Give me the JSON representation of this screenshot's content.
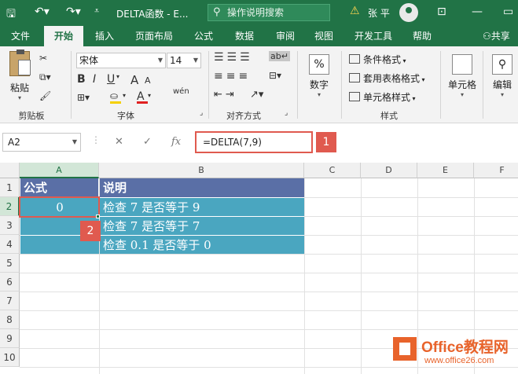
{
  "titlebar": {
    "title": "DELTA函数 - E...",
    "search_placeholder": "操作说明搜索",
    "user": "张 平",
    "save_icon": "save-icon",
    "undo_icon": "undo-icon",
    "redo_icon": "redo-icon"
  },
  "tabs": [
    "文件",
    "开始",
    "插入",
    "页面布局",
    "公式",
    "数据",
    "审阅",
    "视图",
    "开发工具",
    "帮助"
  ],
  "share_label": "共享",
  "ribbon": {
    "clipboard": {
      "paste": "粘贴",
      "label": "剪贴板"
    },
    "font": {
      "name": "宋体",
      "size": "14",
      "bold": "B",
      "italic": "I",
      "underline": "U",
      "grow": "A",
      "shrink": "A",
      "wen": "wén",
      "label": "字体"
    },
    "alignment": {
      "label": "对齐方式"
    },
    "number": {
      "symbol": "%",
      "name": "数字"
    },
    "styles": {
      "cond": "条件格式",
      "table": "套用表格格式",
      "cell": "单元格样式",
      "label": "样式"
    },
    "cells": {
      "name": "单元格"
    },
    "editing": {
      "name": "编辑"
    }
  },
  "formula_bar": {
    "namebox": "A2",
    "formula": "=DELTA(7,9)",
    "cancel": "✕",
    "enter": "✓",
    "fx": "fx",
    "badge1": "1"
  },
  "sheet": {
    "columns": [
      "A",
      "B",
      "C",
      "D",
      "E",
      "F"
    ],
    "rows": [
      "1",
      "2",
      "3",
      "4",
      "5",
      "6",
      "7",
      "8",
      "9",
      "10"
    ],
    "header": {
      "a": "公式",
      "b": "说明"
    },
    "data": [
      {
        "a": "0",
        "b": "检查 7 是否等于 9"
      },
      {
        "a": "",
        "b": "检查 7 是否等于 7"
      },
      {
        "a": "",
        "b": "检查 0.1 是否等于 0"
      }
    ],
    "badge2": "2"
  },
  "watermark": {
    "line1": "Office教程网",
    "line2": "www.office26.com"
  },
  "colors": {
    "accent": "#217346",
    "header_fill": "#5a6fa6",
    "data_fill": "#4aa6c0",
    "highlight": "#e05a4f"
  }
}
